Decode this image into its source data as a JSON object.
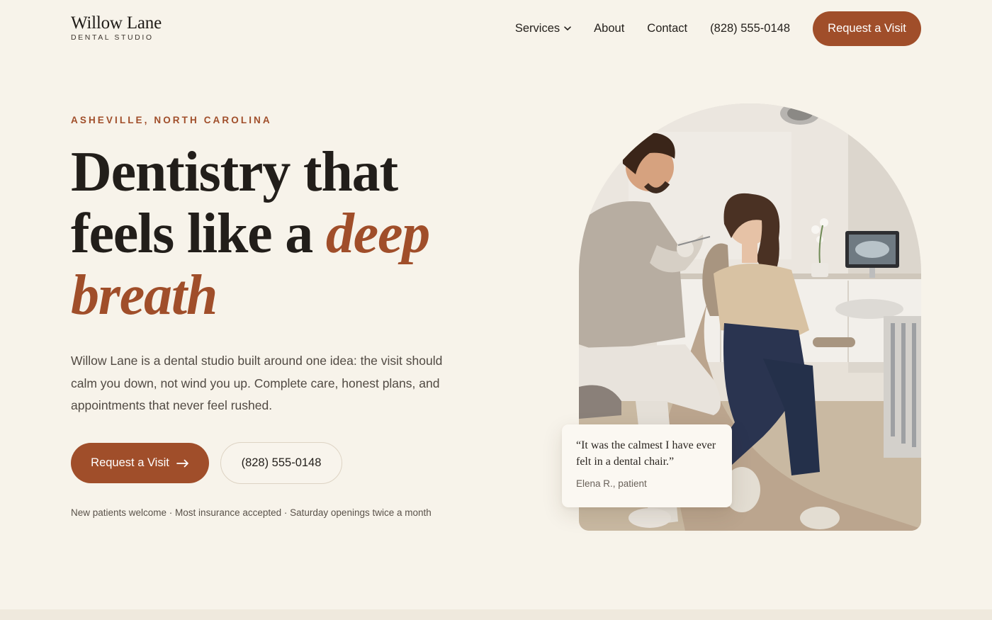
{
  "brand": {
    "name": "Willow Lane",
    "tagline": "DENTAL STUDIO"
  },
  "nav": {
    "items": [
      {
        "label": "Services",
        "has_dropdown": true
      },
      {
        "label": "About"
      },
      {
        "label": "Contact"
      },
      {
        "label": "(828) 555-0148"
      }
    ],
    "cta_label": "Request a Visit"
  },
  "hero": {
    "eyebrow": "ASHEVILLE, NORTH CAROLINA",
    "headline_part1": "Dentistry that feels like a ",
    "headline_accent": "deep breath",
    "lede": "Willow Lane is a dental studio built around one idea: the visit should calm you down, not wind you up. Complete care, honest plans, and appointments that never feel rushed.",
    "primary_cta": "Request a Visit",
    "secondary_cta": "(828) 555-0148",
    "footnote": "New patients welcome · Most insurance accepted · Saturday openings twice a month"
  },
  "testimonial": {
    "quote": "“It was the calmest I have ever felt in a dental chair.”",
    "attribution": "Elena R., patient"
  },
  "colors": {
    "background": "#f7f3ea",
    "accent": "#a04e2a",
    "text": "#231f1b"
  },
  "icons": {
    "nav_dropdown": "chevron-down-icon",
    "cta_arrow": "arrow-right-icon"
  }
}
